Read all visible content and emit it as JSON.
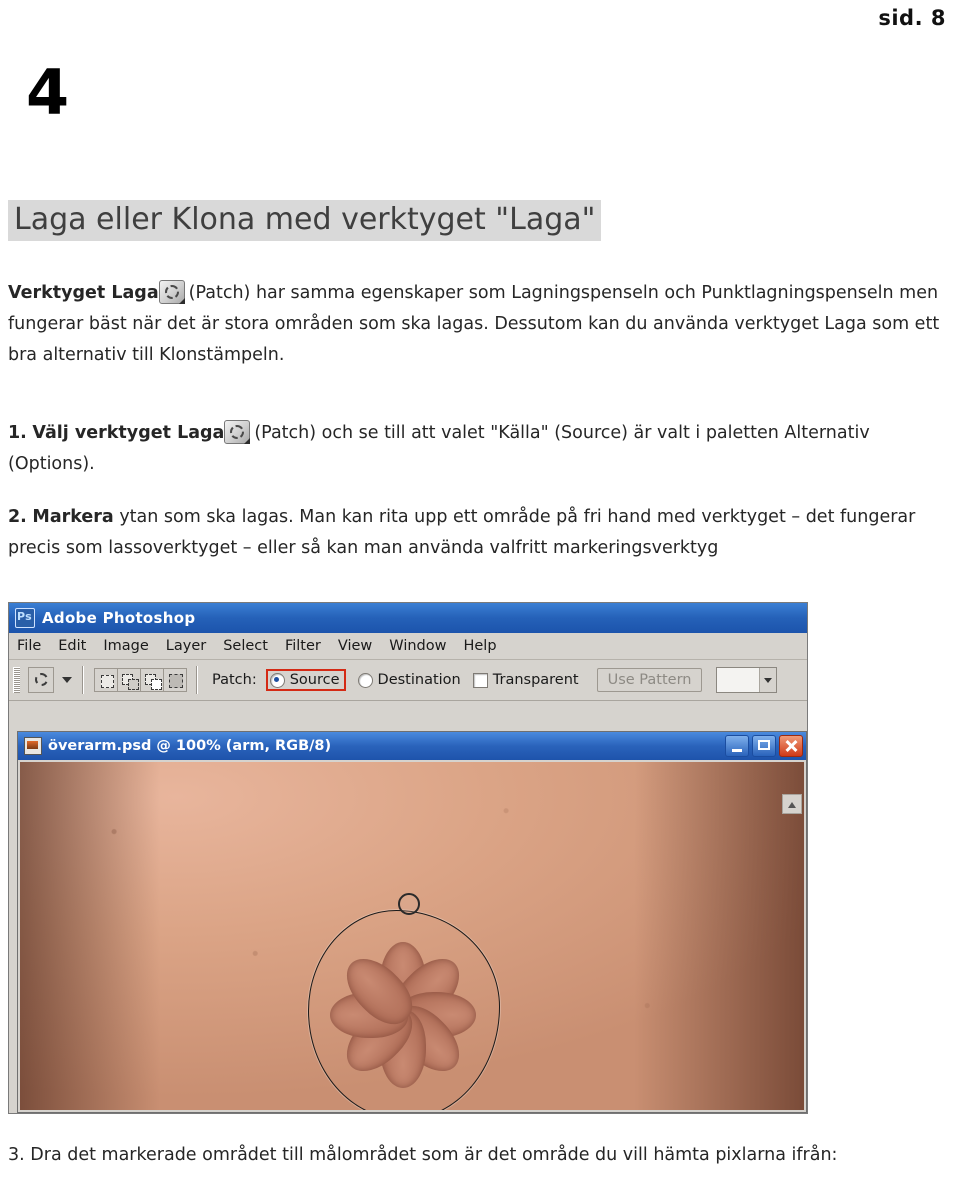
{
  "document": {
    "page_label": "sid. 8",
    "section_number": "4",
    "heading": "Laga eller Klona med verktyget \"Laga\"",
    "paragraphs": {
      "intro_pre_icon": "Verktyget Laga",
      "intro_post_icon": "(Patch) har samma egenskaper som Lagningspenseln och Punktlagningspenseln men fungerar bäst när det är stora områden som ska lagas. Dessutom kan du använda verktyget Laga som ett bra alternativ till Klonstämpeln.",
      "step1_number": "1.",
      "step1_pre_icon": "Välj verktyget Laga",
      "step1_post_icon": "(Patch) och se till att valet \"Källa\" (Source) är valt i paletten Alternativ (Options).",
      "step2_number": "2.",
      "step2_bold": "Markera",
      "step2_rest": "ytan som ska lagas. Man kan rita upp ett område på fri hand med verktyget – det fungerar precis som lassoverktyget – eller så kan man använda valfritt markeringsverktyg",
      "step3_number": "3.",
      "step3_text": "Dra det markerade området till målområdet som är det område du vill hämta pixlarna ifrån:"
    },
    "icon_names": {
      "patch_tool": "patch-tool-icon"
    }
  },
  "photoshop": {
    "title": "Adobe Photoshop",
    "menus": [
      "File",
      "Edit",
      "Image",
      "Layer",
      "Select",
      "Filter",
      "View",
      "Window",
      "Help"
    ],
    "options_bar": {
      "patch_label": "Patch:",
      "radio_source": "Source",
      "radio_destination": "Destination",
      "checkbox_transparent": "Transparent",
      "use_pattern_button": "Use Pattern",
      "selected_radio": "Source",
      "highlight_color": "#d42a15"
    },
    "document_window": {
      "title": "överarm.psd @ 100% (arm, RGB/8)",
      "buttons": {
        "minimize": "minimize-button",
        "maximize": "maximize-button",
        "close": "close-button"
      }
    }
  }
}
